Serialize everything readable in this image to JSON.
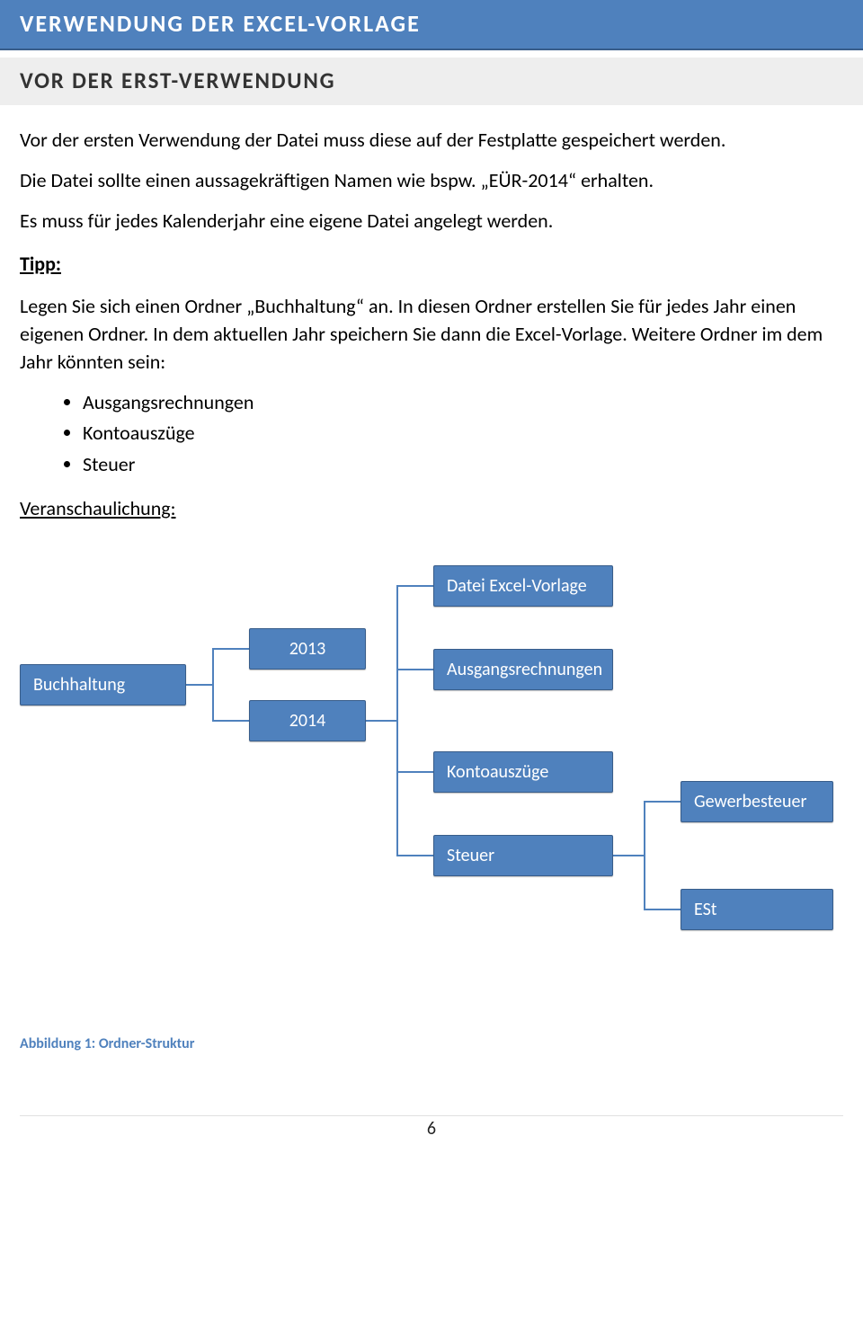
{
  "header": {
    "title": "VERWENDUNG DER EXCEL-VORLAGE"
  },
  "section": {
    "title": "VOR DER ERST-VERWENDUNG"
  },
  "body": {
    "p1": "Vor der ersten Verwendung der Datei muss diese auf der Festplatte gespeichert werden.",
    "p2": "Die Datei sollte einen aussagekräftigen Namen wie bspw. „EÜR-2014“ erhalten.",
    "p3": "Es muss für jedes Kalenderjahr eine eigene Datei angelegt werden.",
    "tipp_label": "Tipp:",
    "p4": "Legen Sie sich einen Ordner „Buchhaltung“ an. In diesen Ordner erstellen Sie für jedes Jahr einen eigenen Ordner. In dem aktuellen Jahr speichern Sie dann die Excel-Vorlage. Weitere Ordner im dem Jahr könnten sein:",
    "bullets": [
      "Ausgangsrechnungen",
      "Kontoauszüge",
      "Steuer"
    ],
    "illustration_label": "Veranschaulichung:"
  },
  "diagram": {
    "root": "Buchhaltung",
    "years": [
      "2013",
      "2014"
    ],
    "subfolders": [
      "Datei Excel-Vorlage",
      "Ausgangsrechnungen",
      "Kontoauszüge",
      "Steuer"
    ],
    "taxes": [
      "Gewerbesteuer",
      "ESt"
    ]
  },
  "caption": "Abbildung 1: Ordner-Struktur",
  "page_number": "6"
}
